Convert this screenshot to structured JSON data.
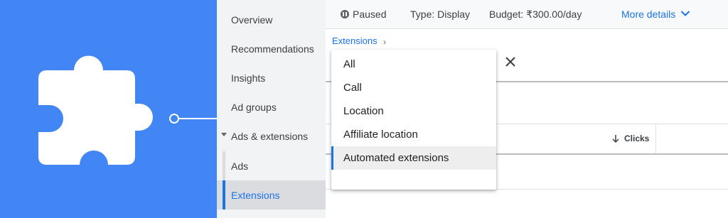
{
  "sidebar": {
    "items": [
      {
        "label": "Overview"
      },
      {
        "label": "Recommendations"
      },
      {
        "label": "Insights"
      },
      {
        "label": "Ad groups"
      },
      {
        "label": "Ads & extensions"
      },
      {
        "label": "Ads"
      },
      {
        "label": "Extensions"
      }
    ],
    "active": "Extensions"
  },
  "topbar": {
    "status": "Paused",
    "type_label": "Type:",
    "type_value": "Display",
    "budget_label": "Budget:",
    "budget_value": "₹300.00/day",
    "more_details": "More details"
  },
  "breadcrumb": {
    "label": "Extensions",
    "separator": "›"
  },
  "dropdown": {
    "options": [
      {
        "label": "All"
      },
      {
        "label": "Call"
      },
      {
        "label": "Location"
      },
      {
        "label": "Affiliate location"
      },
      {
        "label": "Automated extensions"
      }
    ],
    "selected": "Automated extensions"
  },
  "table": {
    "columns": [
      {
        "label": "Clicks",
        "sort": "descending"
      }
    ]
  },
  "icons": {
    "hero": "puzzle-piece-icon",
    "close": "close-icon",
    "more": "chevron-down-icon",
    "sort": "arrow-down-icon",
    "status": "pause-circle-icon"
  },
  "colors": {
    "hero_background": "#4285f4",
    "accent": "#1a73e8",
    "sidebar_background": "#f1f3f4"
  }
}
